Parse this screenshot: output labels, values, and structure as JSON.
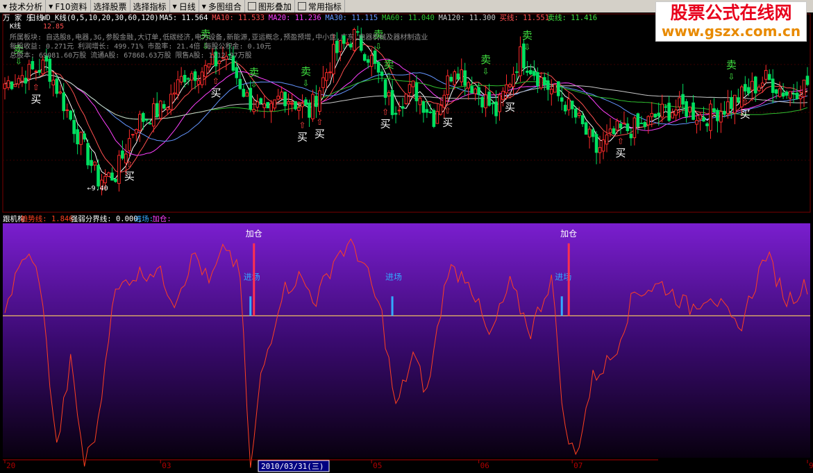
{
  "toolbar": [
    {
      "label": "技术分析",
      "icon": "dropdown-icon"
    },
    {
      "label": "F10资料",
      "icon": "dropdown-icon"
    },
    {
      "label": "选择股票",
      "icon": ""
    },
    {
      "label": "选择指标",
      "icon": ""
    },
    {
      "label": "日线",
      "icon": "dropdown-icon"
    },
    {
      "label": "多图组合",
      "icon": "dropdown-icon"
    },
    {
      "label": "图形叠加",
      "icon": "grid-icon"
    },
    {
      "label": "常用指标",
      "icon": "lock-icon"
    }
  ],
  "watermark": {
    "line1": "股票公式在线网",
    "line2": "www.gszx.com.cn"
  },
  "colors": {
    "background": "#000000",
    "up_candle": "#ff2a2a",
    "down_candle": "#00e060",
    "ma5": "#ffffff",
    "ma10": "#ff5050",
    "ma20": "#ff40ff",
    "ma30": "#6495ff",
    "ma60": "#30c030",
    "ma120": "#c8c8c8",
    "trend_line": "#ff4020",
    "divider_line": "#ffd060",
    "entry_bar": "#33aaff",
    "add_bar": "#ff3050",
    "sell_text": "#40e040",
    "buy_text": "#ffffff"
  },
  "main_panel": {
    "title_prefix": "万 家 乐",
    "period": "日线",
    "formula": "WD_K线(0,5,10,20,30,60,120)",
    "ma_labels": [
      {
        "text": "MA5: 11.564",
        "color": "#ffffff"
      },
      {
        "text": "MA10: 11.533",
        "color": "#ff5050"
      },
      {
        "text": "MA20: 11.236",
        "color": "#ff40ff"
      },
      {
        "text": "MA30: 11.115",
        "color": "#6495ff"
      },
      {
        "text": "MA60: 11.040",
        "color": "#30c030"
      },
      {
        "text": "MA120: 11.300",
        "color": "#c8c8c8"
      },
      {
        "text": "买线: 11.551",
        "color": "#ff5050"
      },
      {
        "text": "卖线: 11.416",
        "color": "#40e040"
      }
    ],
    "kline_label": "K线",
    "high_label": "12.85",
    "info_lines": [
      "所属板块: 自选股8,电器,3G,参股金融,大订单,低碳经济,电力设备,新能源,亚运概念,预盈预增,中小盘,广东,电器机械及器材制造业",
      "每股收益: 0.271元  利润增长: 499.71%  市盈率: 21.4倍  每股公积金: 0.10元",
      "总股本: 69081.60万股  流通A股: 67868.63万股  限售A股: 1212.97万股"
    ],
    "low_label": "9.40",
    "sell_label": "卖",
    "buy_label": "买"
  },
  "sub_panel": {
    "title": "跟机构",
    "trend_label": "趋势线: 1.846",
    "divider_label": "强弱分界线: 0.000,",
    "entry_label": "进场:",
    "add_label": "加仓:",
    "entry_marker": "进场",
    "add_marker": "加仓"
  },
  "x_axis": {
    "ticks": [
      {
        "label": "20",
        "index": 0
      },
      {
        "label": "03",
        "index": 45
      },
      {
        "label": "05",
        "index": 106
      },
      {
        "label": "06",
        "index": 137
      },
      {
        "label": "07",
        "index": 164
      },
      {
        "label": "9",
        "index": 232
      }
    ],
    "selected_date": "2010/03/31(三)"
  },
  "chart_data": {
    "type": "candlestick",
    "ylim": [
      9.0,
      13.0
    ],
    "low": 9.4,
    "high": 12.85,
    "candles_count": 233,
    "close_anchors": [
      [
        0,
        11.6
      ],
      [
        6,
        11.8
      ],
      [
        12,
        12.0
      ],
      [
        20,
        10.7
      ],
      [
        27,
        9.6
      ],
      [
        32,
        9.7
      ],
      [
        38,
        10.8
      ],
      [
        46,
        11.1
      ],
      [
        52,
        11.8
      ],
      [
        58,
        11.9
      ],
      [
        64,
        12.2
      ],
      [
        70,
        11.3
      ],
      [
        76,
        10.9
      ],
      [
        80,
        11.4
      ],
      [
        88,
        11.0
      ],
      [
        95,
        12.2
      ],
      [
        101,
        12.6
      ],
      [
        106,
        12.1
      ],
      [
        112,
        11.1
      ],
      [
        118,
        11.5
      ],
      [
        124,
        10.9
      ],
      [
        130,
        12.0
      ],
      [
        136,
        11.5
      ],
      [
        142,
        11.0
      ],
      [
        149,
        12.2
      ],
      [
        156,
        11.6
      ],
      [
        162,
        11.2
      ],
      [
        166,
        10.8
      ],
      [
        171,
        10.2
      ],
      [
        177,
        10.6
      ],
      [
        184,
        10.7
      ],
      [
        190,
        11.0
      ],
      [
        196,
        11.1
      ],
      [
        202,
        10.9
      ],
      [
        208,
        11.1
      ],
      [
        214,
        11.4
      ],
      [
        220,
        11.7
      ],
      [
        226,
        11.4
      ],
      [
        232,
        11.6
      ]
    ],
    "ma_periods": [
      5,
      10,
      20,
      30,
      60,
      120
    ],
    "signals": [
      {
        "type": "sell",
        "index": 4
      },
      {
        "type": "sell",
        "index": 58
      },
      {
        "type": "sell",
        "index": 72
      },
      {
        "type": "sell",
        "index": 87
      },
      {
        "type": "sell",
        "index": 108
      },
      {
        "type": "sell",
        "index": 111
      },
      {
        "type": "sell",
        "index": 139
      },
      {
        "type": "sell",
        "index": 151
      },
      {
        "type": "sell",
        "index": 210
      },
      {
        "type": "buy",
        "index": 9
      },
      {
        "type": "buy",
        "index": 36
      },
      {
        "type": "buy",
        "index": 61
      },
      {
        "type": "buy",
        "index": 86
      },
      {
        "type": "buy",
        "index": 91
      },
      {
        "type": "buy",
        "index": 110
      },
      {
        "type": "buy",
        "index": 128
      },
      {
        "type": "buy",
        "index": 146
      },
      {
        "type": "buy",
        "index": 178
      },
      {
        "type": "buy",
        "index": 214
      }
    ],
    "indicator": {
      "name": "趋势线",
      "ylim": [
        -2.0,
        1.0
      ],
      "anchors": [
        [
          0,
          0.1
        ],
        [
          6,
          0.8
        ],
        [
          10,
          0.5
        ],
        [
          15,
          -1.7
        ],
        [
          19,
          -0.6
        ],
        [
          23,
          -1.9
        ],
        [
          27,
          -1.4
        ],
        [
          31,
          0.2
        ],
        [
          36,
          0.5
        ],
        [
          44,
          0.6
        ],
        [
          49,
          0.2
        ],
        [
          55,
          0.8
        ],
        [
          59,
          0.4
        ],
        [
          64,
          0.9
        ],
        [
          68,
          0.5
        ],
        [
          71,
          -2.0
        ],
        [
          74,
          -0.8
        ],
        [
          80,
          0.3
        ],
        [
          85,
          0.5
        ],
        [
          90,
          0.2
        ],
        [
          96,
          0.8
        ],
        [
          101,
          0.9
        ],
        [
          105,
          0.5
        ],
        [
          109,
          0.0
        ],
        [
          113,
          -1.2
        ],
        [
          118,
          -0.5
        ],
        [
          122,
          -1.0
        ],
        [
          128,
          0.6
        ],
        [
          134,
          0.5
        ],
        [
          140,
          -0.3
        ],
        [
          146,
          0.4
        ],
        [
          152,
          -0.2
        ],
        [
          158,
          0.5
        ],
        [
          162,
          -1.5
        ],
        [
          165,
          -1.8
        ],
        [
          170,
          -0.8
        ],
        [
          176,
          -0.5
        ],
        [
          182,
          0.3
        ],
        [
          190,
          0.4
        ],
        [
          198,
          0.1
        ],
        [
          204,
          0.3
        ],
        [
          212,
          -0.2
        ],
        [
          220,
          0.8
        ],
        [
          226,
          0.2
        ],
        [
          232,
          0.4
        ]
      ],
      "divider": 0.0,
      "entries": [
        71,
        112,
        161
      ],
      "adds": [
        72,
        163
      ]
    }
  }
}
